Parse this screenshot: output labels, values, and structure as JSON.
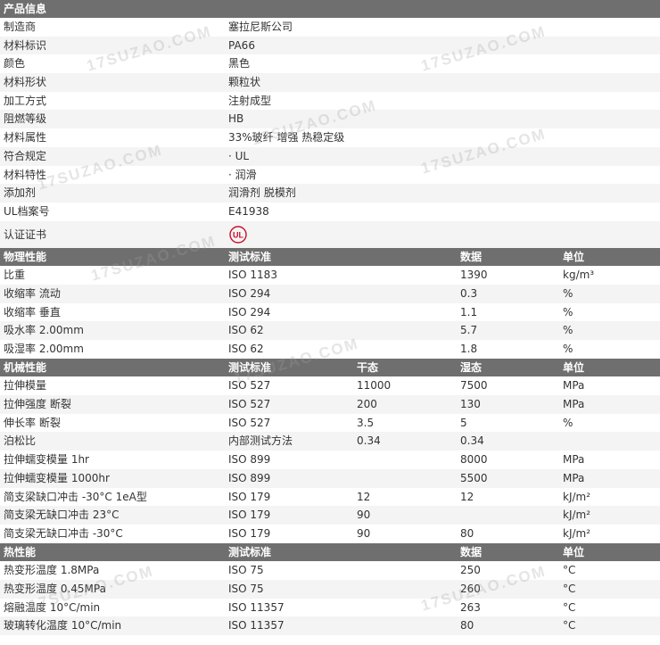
{
  "product": {
    "title": "产品信息",
    "rows": [
      {
        "label": "制造商",
        "value": "塞拉尼斯公司"
      },
      {
        "label": "材料标识",
        "value": "PA66"
      },
      {
        "label": "颜色",
        "value": "黑色"
      },
      {
        "label": "材料形状",
        "value": "颗粒状"
      },
      {
        "label": "加工方式",
        "value": "注射成型"
      },
      {
        "label": "阻燃等级",
        "value": "HB"
      },
      {
        "label": "材料属性",
        "value": "33%玻纤 增强 热稳定级"
      },
      {
        "label": "符合规定",
        "value": "· UL"
      },
      {
        "label": "材料特性",
        "value": "· 润滑"
      },
      {
        "label": "添加剂",
        "value": "润滑剂 脱模剂"
      },
      {
        "label": "UL档案号",
        "value": "E41938"
      }
    ],
    "cert_label": "认证证书",
    "cert_logo_text": "UL"
  },
  "physical": {
    "headers": [
      "物理性能",
      "测试标准",
      "数据",
      "单位"
    ],
    "rows": [
      {
        "name": "比重",
        "std": "ISO 1183",
        "data": "1390",
        "unit": "kg/m³"
      },
      {
        "name": "收缩率   流动",
        "std": "ISO 294",
        "data": "0.3",
        "unit": "%"
      },
      {
        "name": "收缩率   垂直",
        "std": "ISO 294",
        "data": "1.1",
        "unit": "%"
      },
      {
        "name": "吸水率   2.00mm",
        "std": "ISO 62",
        "data": "5.7",
        "unit": "%"
      },
      {
        "name": "吸湿率   2.00mm",
        "std": "ISO 62",
        "data": "1.8",
        "unit": "%"
      }
    ]
  },
  "mechanical": {
    "headers": [
      "机械性能",
      "测试标准",
      "干态",
      "湿态",
      "单位"
    ],
    "rows": [
      {
        "name": "拉伸模量",
        "std": "ISO 527",
        "dry": "11000",
        "wet": "7500",
        "unit": "MPa"
      },
      {
        "name": "拉伸强度   断裂",
        "std": "ISO 527",
        "dry": "200",
        "wet": "130",
        "unit": "MPa"
      },
      {
        "name": "伸长率   断裂",
        "std": "ISO 527",
        "dry": "3.5",
        "wet": "5",
        "unit": "%"
      },
      {
        "name": "泊松比",
        "std": "内部测试方法",
        "dry": "0.34",
        "wet": "0.34",
        "unit": ""
      },
      {
        "name": "拉伸蠕变模量   1hr",
        "std": "ISO 899",
        "dry": "",
        "wet": "8000",
        "unit": "MPa"
      },
      {
        "name": "拉伸蠕变模量   1000hr",
        "std": "ISO 899",
        "dry": "",
        "wet": "5500",
        "unit": "MPa"
      },
      {
        "name": "简支梁缺口冲击   -30°C 1eA型",
        "std": "ISO 179",
        "dry": "12",
        "wet": "12",
        "unit": "kJ/m²"
      },
      {
        "name": "简支梁无缺口冲击   23°C",
        "std": "ISO 179",
        "dry": "90",
        "wet": "",
        "unit": "kJ/m²"
      },
      {
        "name": "简支梁无缺口冲击   -30°C",
        "std": "ISO 179",
        "dry": "90",
        "wet": "80",
        "unit": "kJ/m²"
      }
    ]
  },
  "thermal": {
    "headers": [
      "热性能",
      "测试标准",
      "数据",
      "单位"
    ],
    "rows": [
      {
        "name": "热变形温度   1.8MPa",
        "std": "ISO 75",
        "data": "250",
        "unit": "°C"
      },
      {
        "name": "热变形温度   0.45MPa",
        "std": "ISO 75",
        "data": "260",
        "unit": "°C"
      },
      {
        "name": "熔融温度   10°C/min",
        "std": "ISO 11357",
        "data": "263",
        "unit": "°C"
      },
      {
        "name": "玻璃转化温度   10°C/min",
        "std": "ISO 11357",
        "data": "80",
        "unit": "°C"
      }
    ]
  },
  "watermark": "17SUZAO.COM",
  "colors": {
    "header_bg": "#6f6f6f",
    "alt_row": "#f4f4f4",
    "ul_logo": "#c8102e"
  }
}
